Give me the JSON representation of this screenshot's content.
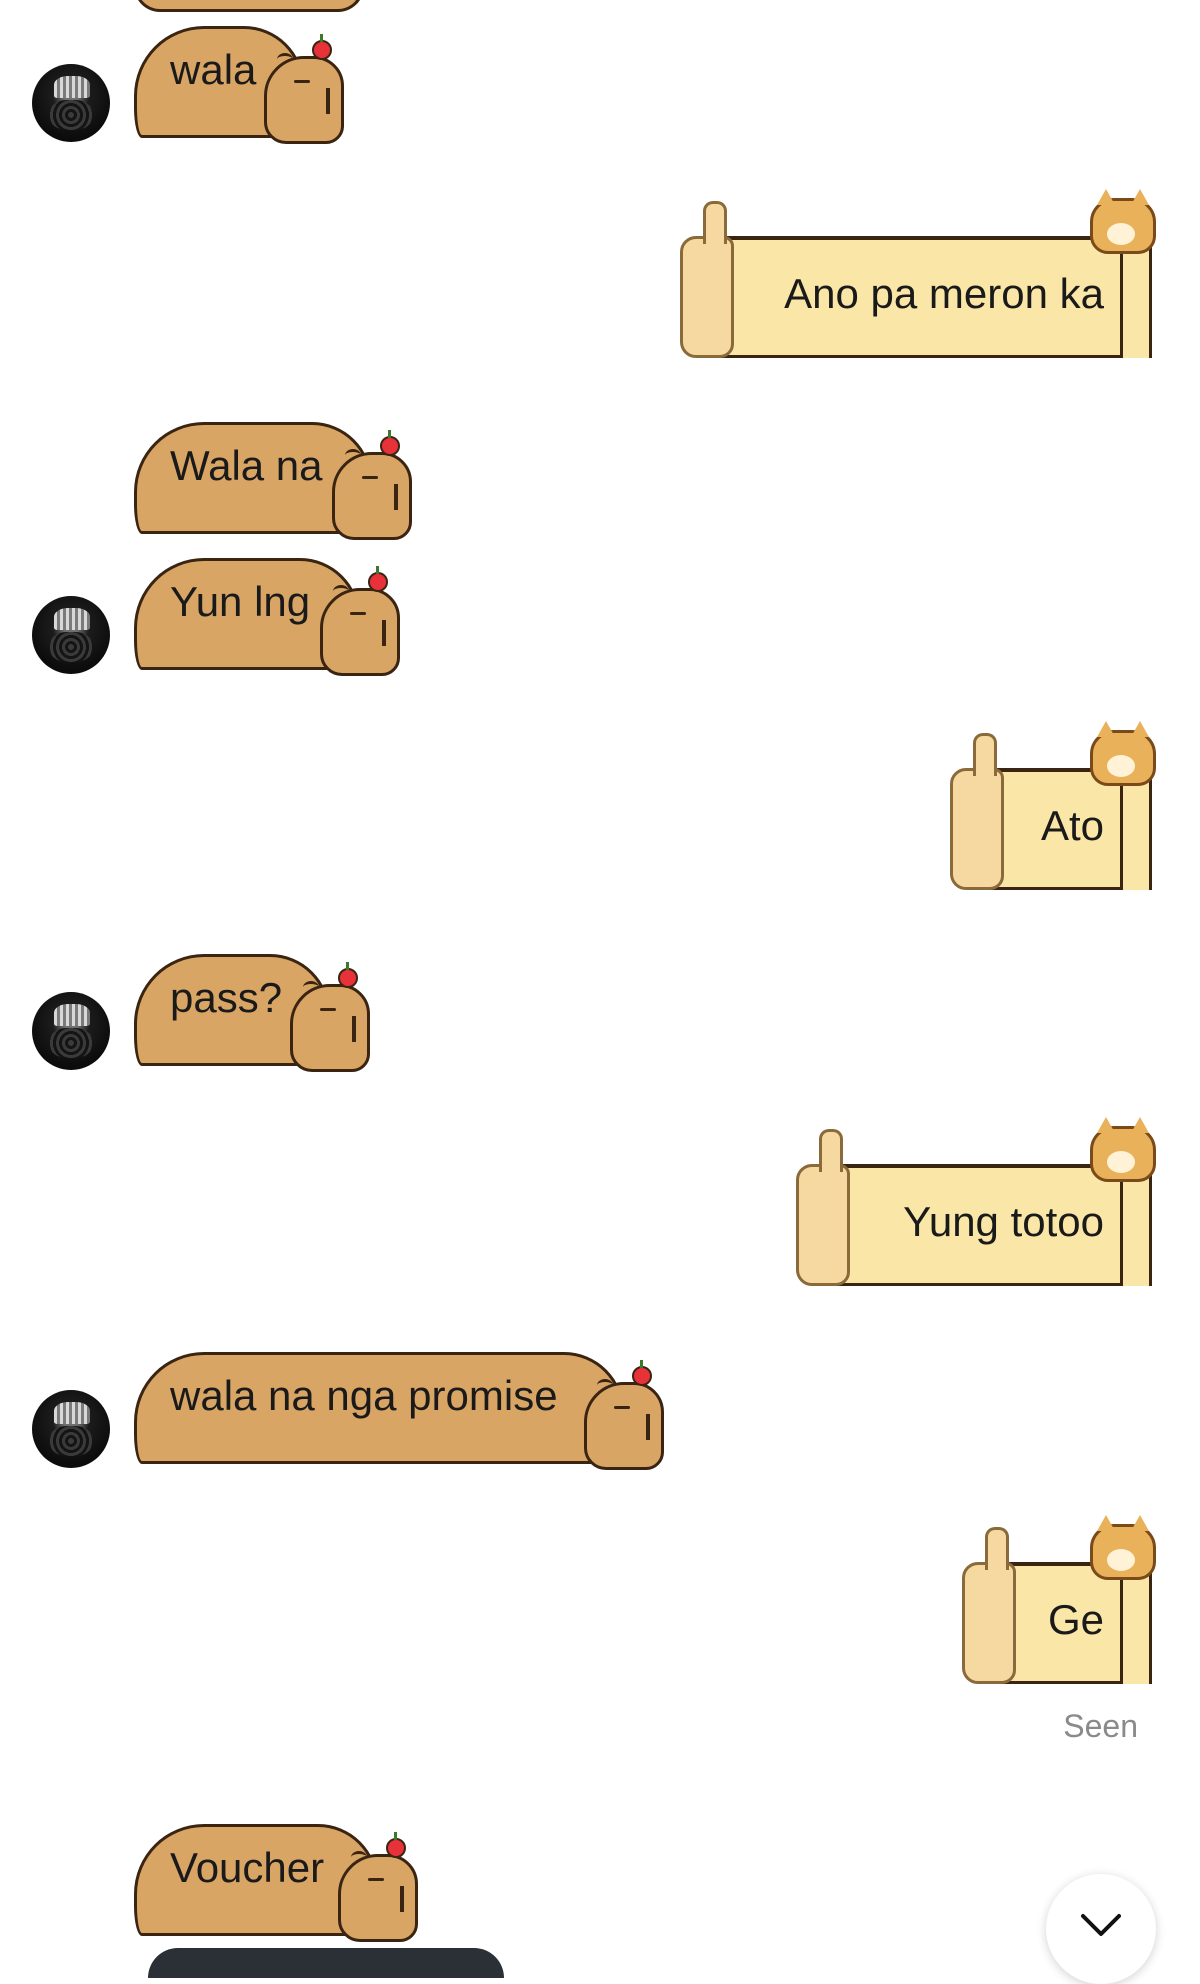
{
  "messages": [
    {
      "side": "received",
      "text": "wala",
      "avatar": true
    },
    {
      "side": "sent",
      "text": "Ano pa meron ka"
    },
    {
      "side": "received",
      "text": "Wala na",
      "avatar": false
    },
    {
      "side": "received",
      "text": "Yun lng",
      "avatar": true
    },
    {
      "side": "sent",
      "text": "Ato"
    },
    {
      "side": "received",
      "text": "pass?",
      "avatar": true
    },
    {
      "side": "sent",
      "text": "Yung totoo"
    },
    {
      "side": "received",
      "text": "wala na nga promise",
      "avatar": true
    },
    {
      "side": "sent",
      "text": "Ge"
    },
    {
      "side": "received",
      "text": "Voucher",
      "avatar": false
    }
  ],
  "status": {
    "seen_label": "Seen"
  },
  "controls": {
    "scroll_icon": "chevron-down-icon"
  },
  "colors": {
    "capy_body": "#d9a565",
    "doge_sign": "#fae6a6",
    "outline": "#3a2412"
  }
}
